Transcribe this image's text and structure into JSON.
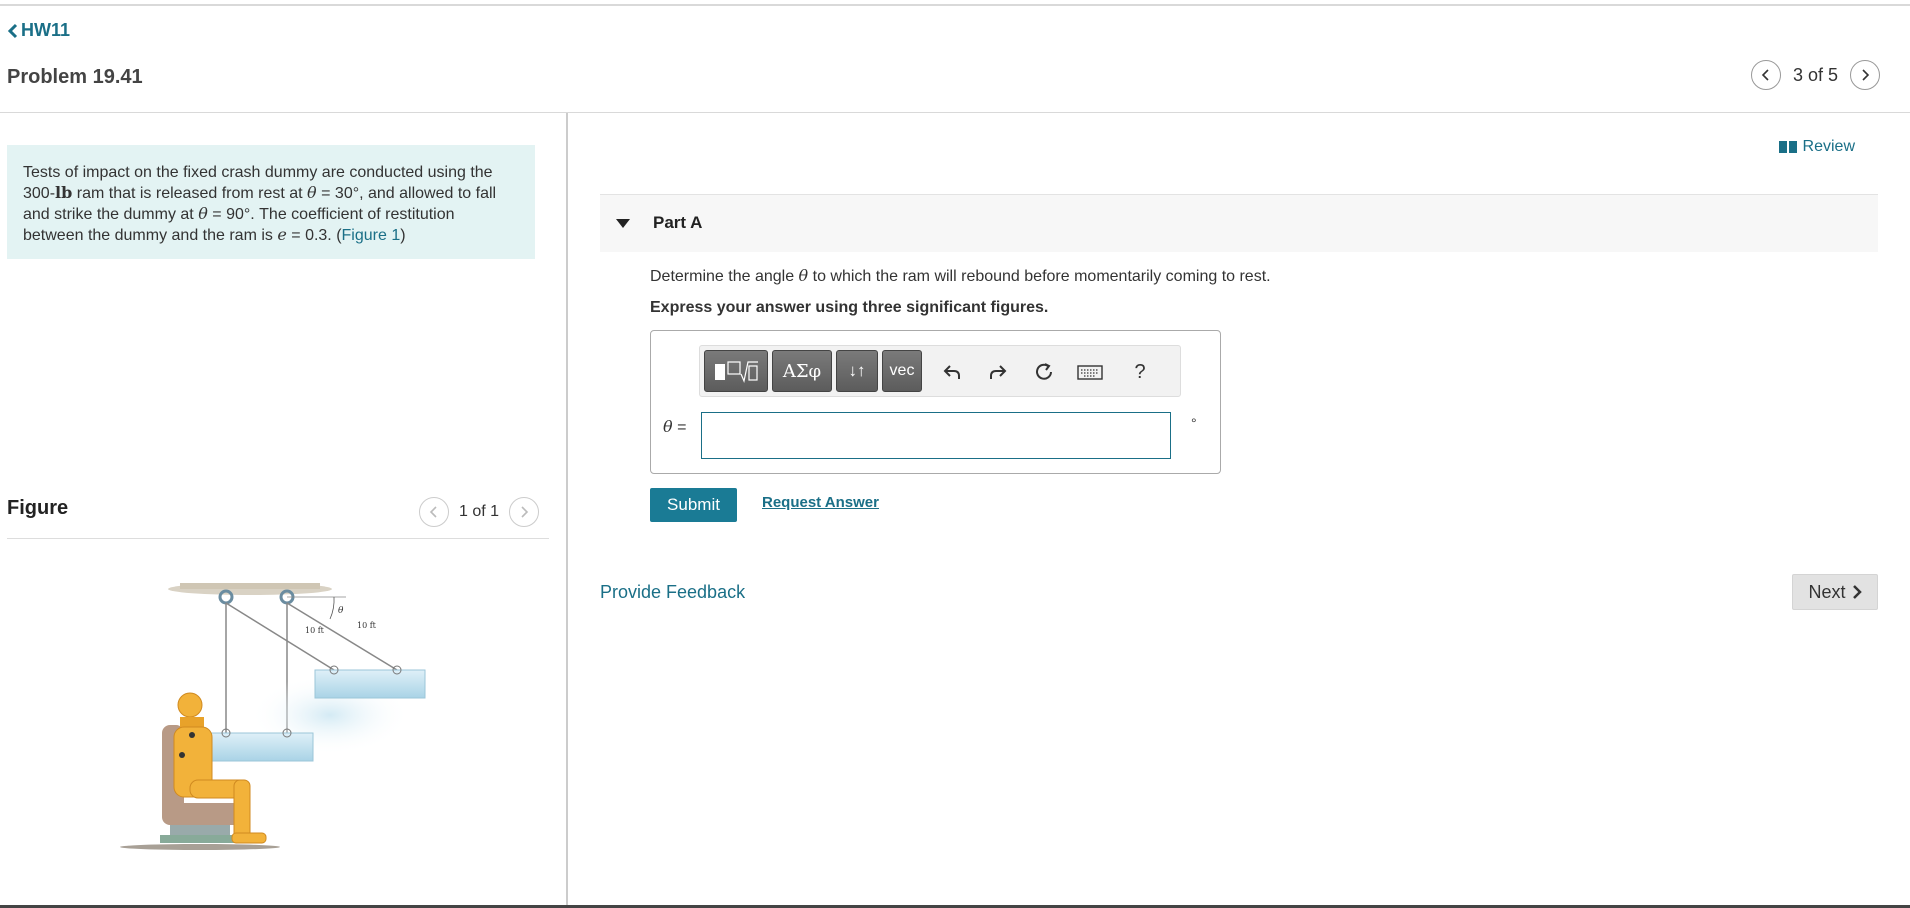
{
  "nav": {
    "back_label": "HW11"
  },
  "problem": {
    "title": "Problem 19.41"
  },
  "pager": {
    "text": "3 of 5"
  },
  "intro": {
    "t1": "Tests of impact on the fixed crash dummy are conducted using the",
    "weight_value": "300-",
    "weight_unit": "lb",
    "t2": " ram that is released from rest at ",
    "theta": "θ",
    "t3": " = 30°, and allowed to fall and strike the dummy at ",
    "t4": " = 90°. The coefficient of restitution between the dummy and the ram is ",
    "e": "e",
    "t5": " = 0.3. (",
    "figure_link": "Figure 1",
    "t6": ")"
  },
  "figure": {
    "header": "Figure",
    "pager": "1 of 1",
    "label_theta": "θ",
    "label_len1": "10 ft",
    "label_len2": "10 ft"
  },
  "review": {
    "label": "Review"
  },
  "part": {
    "title": "Part A",
    "question_pre": "Determine the angle ",
    "question_theta": "θ",
    "question_post": " to which the ram will rebound before momentarily coming to rest.",
    "instruction": "Express your answer using three significant figures."
  },
  "toolbar": {
    "templates_icon": "templates-icon",
    "symbols_label": "ΑΣφ",
    "updown_label": "↓↑",
    "vec_label": "vec",
    "help_label": "?"
  },
  "answer": {
    "var_label": "θ",
    "eq": " =",
    "value": "",
    "unit": "°"
  },
  "buttons": {
    "submit": "Submit",
    "request": "Request Answer",
    "feedback": "Provide Feedback",
    "next": "Next"
  },
  "colors": {
    "accent": "#1a6f87",
    "submit_bg": "#1a7b95",
    "intro_bg": "#e3f3f3"
  }
}
